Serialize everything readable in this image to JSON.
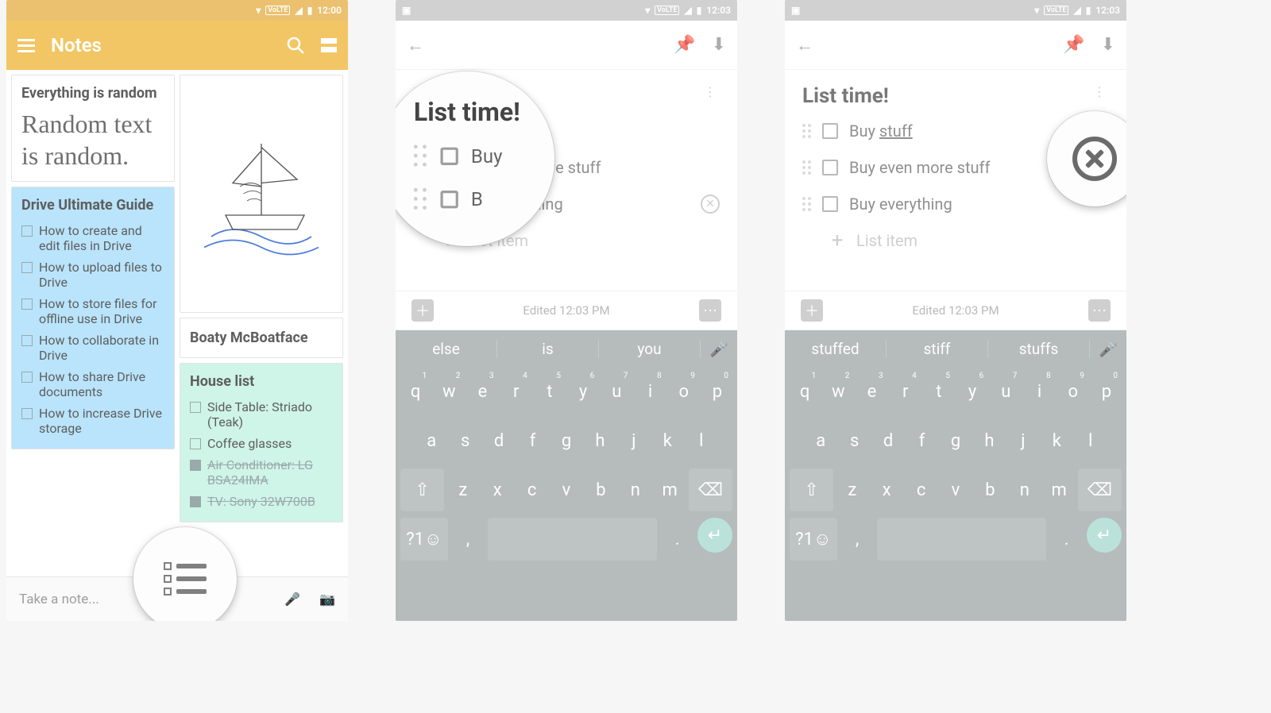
{
  "screen1": {
    "status": {
      "time": "12:00",
      "volte": "VoLTE"
    },
    "appbar": {
      "title": "Notes"
    },
    "cards": {
      "random": {
        "title": "Everything is random",
        "body": "Random text is random."
      },
      "drive": {
        "title": "Drive Ultimate Guide",
        "items": [
          "How to create and edit files in Drive",
          "How to upload files to Drive",
          "How to store files for offline use in Drive",
          "How to collaborate in Drive",
          "How to share Drive documents",
          "How to increase Drive storage"
        ]
      },
      "boat": {
        "title": "Boaty McBoatface"
      },
      "house": {
        "title": "House list",
        "items": [
          {
            "txt": "Side Table: Striado (Teak)",
            "done": false
          },
          {
            "txt": "Coffee glasses",
            "done": false
          },
          {
            "txt": "Air Conditioner: LG BSA24IMA",
            "done": true
          },
          {
            "txt": "TV: Sony 32W700B",
            "done": true
          }
        ]
      }
    },
    "bottombar": {
      "hint": "Take a note..."
    }
  },
  "screen2": {
    "status": {
      "time": "12:03",
      "volte": "VoLTE"
    },
    "title": "List time!",
    "items": [
      {
        "txt_full": "Buy stuff",
        "txt_mag": "Buy"
      },
      {
        "txt_full": "Buy even more stuff",
        "txt_mag": "B"
      },
      {
        "txt_full": "Buy everything"
      }
    ],
    "add_label": "List item",
    "edited": "Edited 12:03 PM",
    "suggestions": [
      "else",
      "is",
      "you"
    ]
  },
  "screen3": {
    "status": {
      "time": "12:03",
      "volte": "VoLTE"
    },
    "title": "List time!",
    "items": [
      {
        "pre": "Buy ",
        "under": "stuff"
      },
      {
        "txt": "Buy even more stuff"
      },
      {
        "txt": "Buy everything"
      }
    ],
    "add_label": "List item",
    "edited": "Edited 12:03 PM",
    "suggestions": [
      "stuffed",
      "stiff",
      "stuffs"
    ]
  },
  "keyboard": {
    "r1": [
      [
        "q",
        "1"
      ],
      [
        "w",
        "2"
      ],
      [
        "e",
        "3"
      ],
      [
        "r",
        "4"
      ],
      [
        "t",
        "5"
      ],
      [
        "y",
        "6"
      ],
      [
        "u",
        "7"
      ],
      [
        "i",
        "8"
      ],
      [
        "o",
        "9"
      ],
      [
        "p",
        "0"
      ]
    ],
    "r2": [
      "a",
      "s",
      "d",
      "f",
      "g",
      "h",
      "j",
      "k",
      "l"
    ],
    "r3": [
      "z",
      "x",
      "c",
      "v",
      "b",
      "n",
      "m"
    ],
    "sym": "?1☺",
    "comma": ",",
    "period": "."
  }
}
